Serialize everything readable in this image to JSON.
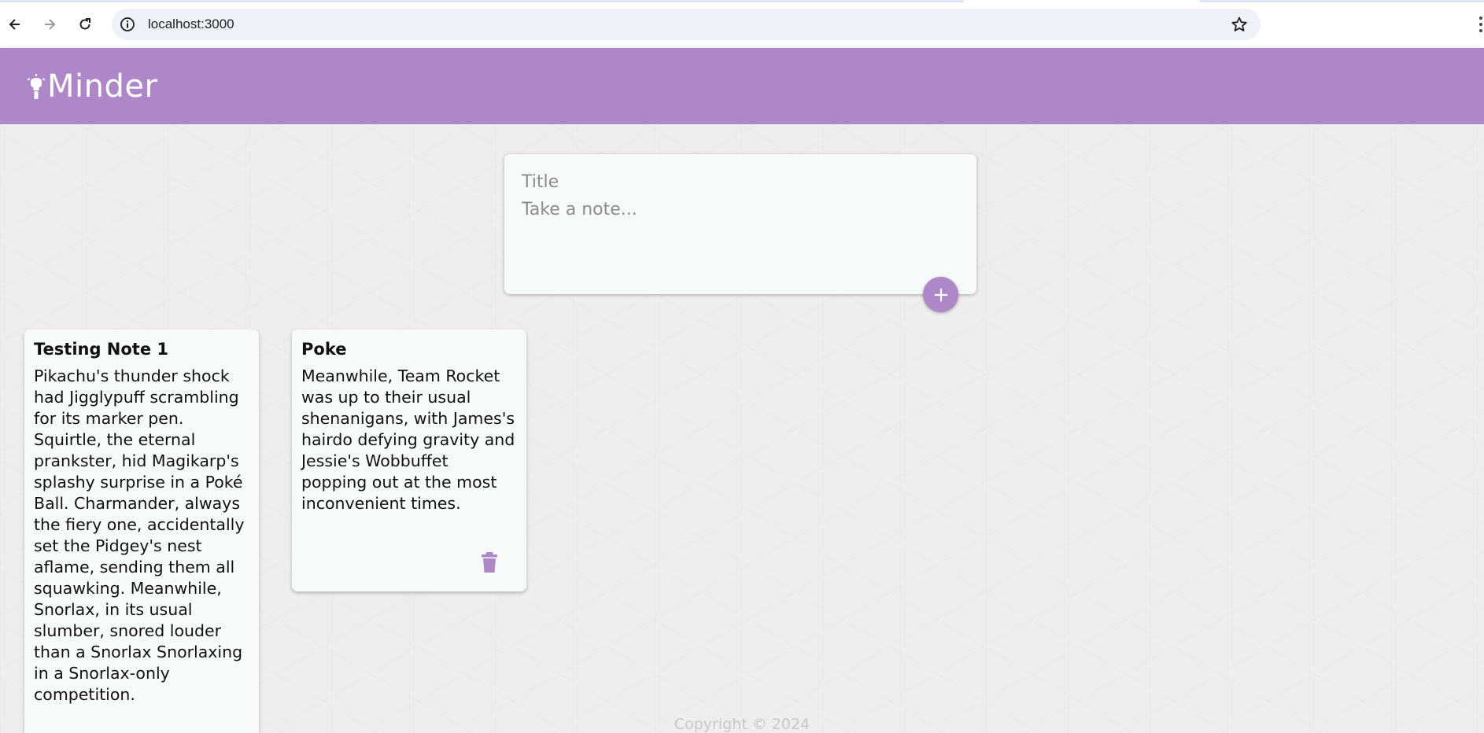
{
  "browser": {
    "url": "localhost:3000",
    "icons": {
      "back": "arrow-left-icon",
      "forward": "arrow-right-icon",
      "reload": "reload-icon",
      "site_info": "info-icon",
      "bookmark": "star-icon",
      "menu": "kebab-menu-icon"
    }
  },
  "header": {
    "brand": "Minder",
    "brand_icon": "lightbulb-icon",
    "background_color": "#ad87c7"
  },
  "create_note": {
    "title_placeholder": "Title",
    "content_placeholder": "Take a note...",
    "add_icon": "plus-icon"
  },
  "notes": [
    {
      "title": "Testing Note 1",
      "content": "Pikachu's thunder shock had Jigglypuff scrambling for its marker pen. Squirtle, the eternal prankster, hid Magikarp's splashy surprise in a Poké Ball. Charmander, always the fiery one, accidentally set the Pidgey's nest aflame, sending them all squawking. Meanwhile, Snorlax, in its usual slumber, snored louder than a Snorlax Snorlaxing in a Snorlax-only competition."
    },
    {
      "title": "Poke",
      "content": "Meanwhile, Team Rocket was up to their usual shenanigans, with James's hairdo defying gravity and Jessie's Wobbuffet popping out at the most inconvenient times.",
      "delete_icon": "trash-icon"
    }
  ],
  "footer": {
    "copyright": "Copyright © 2024"
  },
  "colors": {
    "accent": "#ad87c7",
    "card": "#f7fafb",
    "page_background": "#eeeeee"
  }
}
